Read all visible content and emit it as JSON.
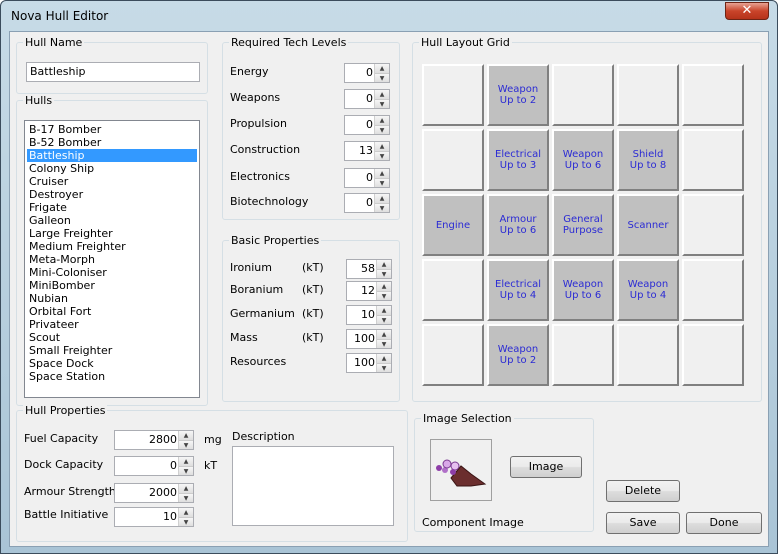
{
  "window": {
    "title": "Nova Hull Editor",
    "close_label": "✕"
  },
  "hull_name": {
    "label": "Hull Name",
    "value": "Battleship"
  },
  "hulls": {
    "label": "Hulls",
    "items": [
      "B-17 Bomber",
      "B-52 Bomber",
      "Battleship",
      "Colony Ship",
      "Cruiser",
      "Destroyer",
      "Frigate",
      "Galleon",
      "Large Freighter",
      "Medium Freighter",
      "Meta-Morph",
      "Mini-Coloniser",
      "MiniBomber",
      "Nubian",
      "Orbital Fort",
      "Privateer",
      "Scout",
      "Small Freighter",
      "Space Dock",
      "Space Station"
    ],
    "selected_index": 2
  },
  "tech": {
    "label": "Required Tech Levels",
    "rows": [
      {
        "name": "Energy",
        "value": "0"
      },
      {
        "name": "Weapons",
        "value": "0"
      },
      {
        "name": "Propulsion",
        "value": "0"
      },
      {
        "name": "Construction",
        "value": "13"
      },
      {
        "name": "Electronics",
        "value": "0"
      },
      {
        "name": "Biotechnology",
        "value": "0"
      }
    ]
  },
  "basic": {
    "label": "Basic Properties",
    "rows": [
      {
        "name": "Ironium",
        "unit": "(kT)",
        "value": "58"
      },
      {
        "name": "Boranium",
        "unit": "(kT)",
        "value": "12"
      },
      {
        "name": "Germanium",
        "unit": "(kT)",
        "value": "10"
      },
      {
        "name": "Mass",
        "unit": "(kT)",
        "value": "100"
      },
      {
        "name": "Resources",
        "unit": "",
        "value": "100"
      }
    ]
  },
  "grid": {
    "label": "Hull Layout Grid",
    "cells": [
      [
        "",
        "Weapon\nUp to 2",
        "",
        "",
        ""
      ],
      [
        "",
        "Electrical\nUp to 3",
        "Weapon\nUp to 6",
        "Shield\nUp to 8",
        ""
      ],
      [
        "Engine",
        "Armour\nUp to 6",
        "General\nPurpose",
        "Scanner",
        ""
      ],
      [
        "",
        "Electrical\nUp to 4",
        "Weapon\nUp to 6",
        "Weapon\nUp to 4",
        ""
      ],
      [
        "",
        "Weapon\nUp to 2",
        "",
        "",
        ""
      ]
    ],
    "filled": [
      [
        false,
        true,
        false,
        false,
        false
      ],
      [
        false,
        true,
        true,
        true,
        false
      ],
      [
        true,
        true,
        true,
        true,
        false
      ],
      [
        false,
        true,
        true,
        true,
        false
      ],
      [
        false,
        true,
        false,
        false,
        false
      ]
    ]
  },
  "hull_props": {
    "label": "Hull Properties",
    "fuel": {
      "label": "Fuel Capacity",
      "value": "2800",
      "unit": "mg"
    },
    "dock": {
      "label": "Dock Capacity",
      "value": "0",
      "unit": "kT"
    },
    "armour": {
      "label": "Armour Strength",
      "value": "2000"
    },
    "initiative": {
      "label": "Battle Initiative",
      "value": "10"
    },
    "description_label": "Description"
  },
  "image_sel": {
    "label": "Image Selection",
    "button": "Image",
    "caption": "Component Image"
  },
  "buttons": {
    "delete": "Delete",
    "save": "Save",
    "done": "Done"
  }
}
